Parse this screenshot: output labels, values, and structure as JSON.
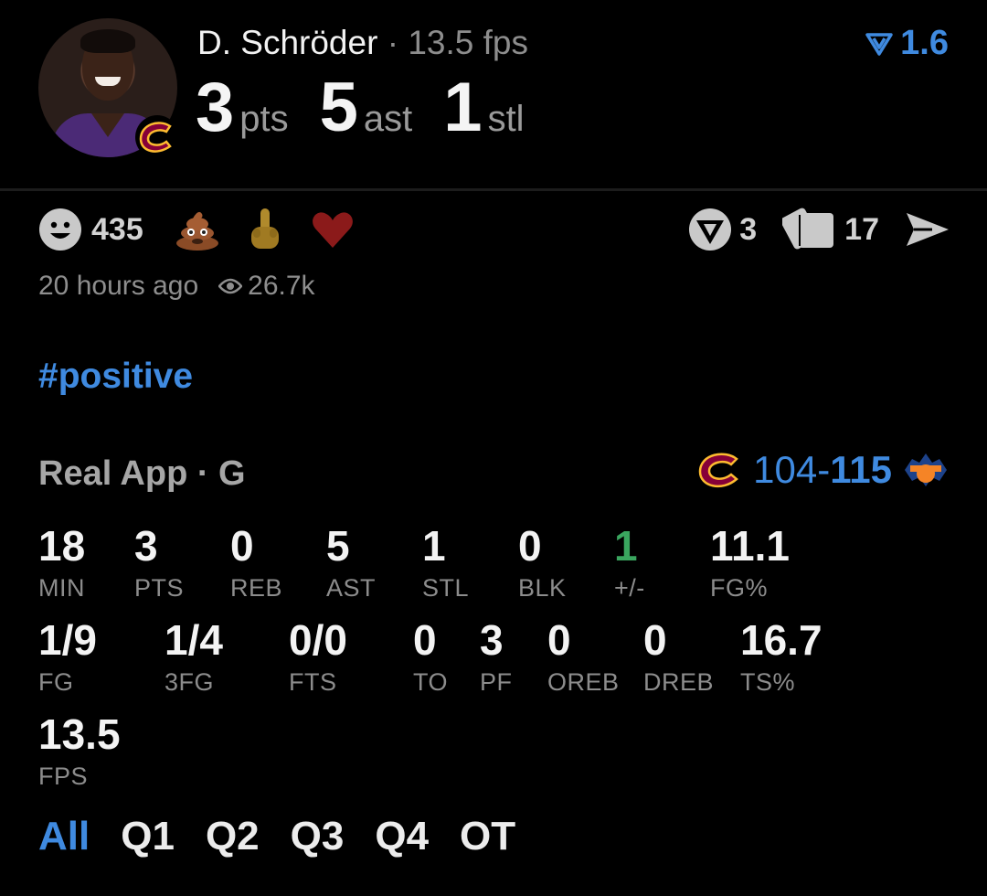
{
  "player": {
    "name": "D. Schröder",
    "separator": "·",
    "fps_text": "13.5 fps",
    "headline": [
      {
        "num": "3",
        "unit": "pts"
      },
      {
        "num": "5",
        "unit": "ast"
      },
      {
        "num": "1",
        "unit": "stl"
      }
    ]
  },
  "version": {
    "value": "1.6",
    "icon": "filter-v-icon"
  },
  "reactions": {
    "smile_count": "435",
    "emojis": [
      "poop-emoji",
      "middle-finger-emoji",
      "heart-emoji"
    ]
  },
  "actions": {
    "comments_count": "3",
    "cards_count": "17",
    "share_icon": "send-icon"
  },
  "meta": {
    "time_ago": "20 hours ago",
    "views": "26.7k"
  },
  "hashtag": "#positive",
  "game": {
    "label": "Real App · G",
    "score_away": "104-",
    "score_home": "115",
    "away_team_logo": "cavaliers-logo",
    "home_team_logo": "knicks-logo"
  },
  "stats_row1": [
    {
      "value": "18",
      "label": "MIN"
    },
    {
      "value": "3",
      "label": "PTS"
    },
    {
      "value": "0",
      "label": "REB"
    },
    {
      "value": "5",
      "label": "AST"
    },
    {
      "value": "1",
      "label": "STL"
    },
    {
      "value": "0",
      "label": "BLK"
    },
    {
      "value": "1",
      "label": "+/-"
    },
    {
      "value": "11.1",
      "label": "FG%"
    }
  ],
  "stats_row2": [
    {
      "value": "1/9",
      "label": "FG"
    },
    {
      "value": "1/4",
      "label": "3FG"
    },
    {
      "value": "0/0",
      "label": "FTS"
    },
    {
      "value": "0",
      "label": "TO"
    },
    {
      "value": "3",
      "label": "PF"
    },
    {
      "value": "0",
      "label": "OREB"
    },
    {
      "value": "0",
      "label": "DREB"
    },
    {
      "value": "16.7",
      "label": "TS%"
    }
  ],
  "stats_row3": [
    {
      "value": "13.5",
      "label": "FPS"
    }
  ],
  "tabs": [
    "All",
    "Q1",
    "Q2",
    "Q3",
    "Q4",
    "OT"
  ],
  "colors": {
    "accent": "#3f8ae0",
    "positive": "#3aa65f",
    "muted": "#8c8c8c"
  }
}
